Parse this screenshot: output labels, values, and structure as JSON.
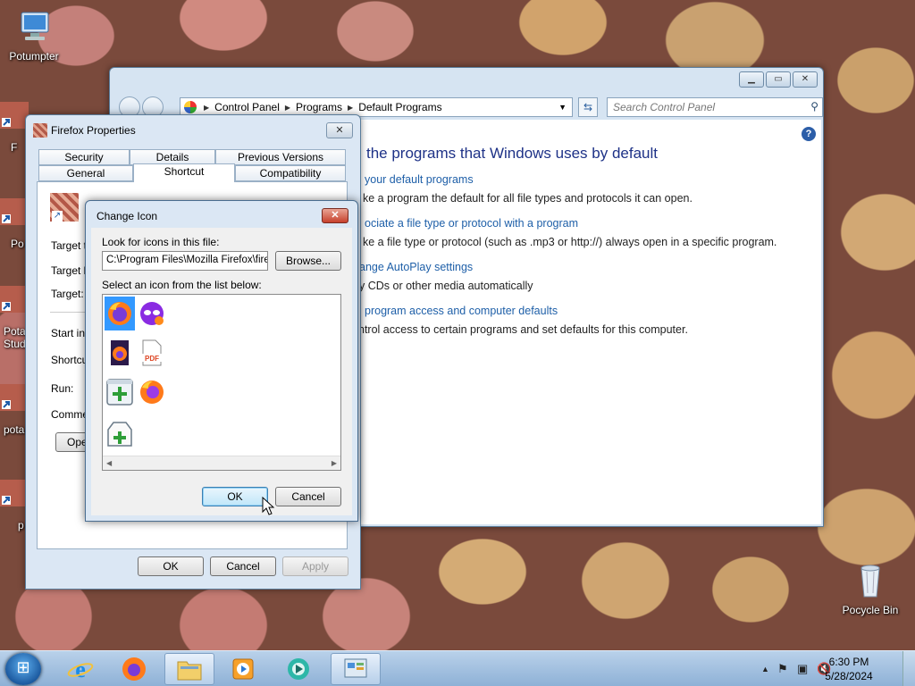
{
  "desktop": {
    "icons": [
      {
        "label": "Potumpter"
      },
      {
        "label": "F"
      },
      {
        "label": "Po"
      },
      {
        "label": "Pota Stud"
      },
      {
        "label": "pota"
      },
      {
        "label": "p"
      }
    ],
    "recycle_bin": {
      "label": "Pocycle Bin"
    }
  },
  "control_panel": {
    "breadcrumbs": [
      "Control Panel",
      "Programs",
      "Default Programs"
    ],
    "search_placeholder": "Search Control Panel",
    "heading": "the programs that Windows uses by default",
    "items": [
      {
        "link": "your default programs",
        "desc": "ke a program the default for all file types and protocols it can open."
      },
      {
        "link": "ociate a file type or protocol with a program",
        "desc": "ke a file type or protocol (such as .mp3 or http://) always open in a specific program."
      },
      {
        "link": "ange AutoPlay settings",
        "desc": "y CDs or other media automatically"
      },
      {
        "link": "program access and computer defaults",
        "desc": "ntrol access to certain programs and set defaults for this computer."
      }
    ]
  },
  "ff_props": {
    "title": "Firefox Properties",
    "tabs_row1": [
      "Security",
      "Details",
      "Previous Versions"
    ],
    "tabs_row2": [
      "General",
      "Shortcut",
      "Compatibility"
    ],
    "labels": [
      "Target ty",
      "Target lo",
      "Target:",
      "Start in:",
      "Shortcut",
      "Run:",
      "Commen"
    ],
    "open_button": "Oper",
    "ok": "OK",
    "cancel": "Cancel",
    "apply": "Apply"
  },
  "change_icon": {
    "title": "Change Icon",
    "look_label": "Look for icons in this file:",
    "path_value": "C:\\Program Files\\Mozilla Firefox\\firefox.exe",
    "browse": "Browse...",
    "select_label": "Select an icon from the list below:",
    "ok": "OK",
    "cancel": "Cancel",
    "pdf_label": "PDF"
  },
  "taskbar": {
    "time": "6:30 PM",
    "date": "5/28/2024"
  }
}
